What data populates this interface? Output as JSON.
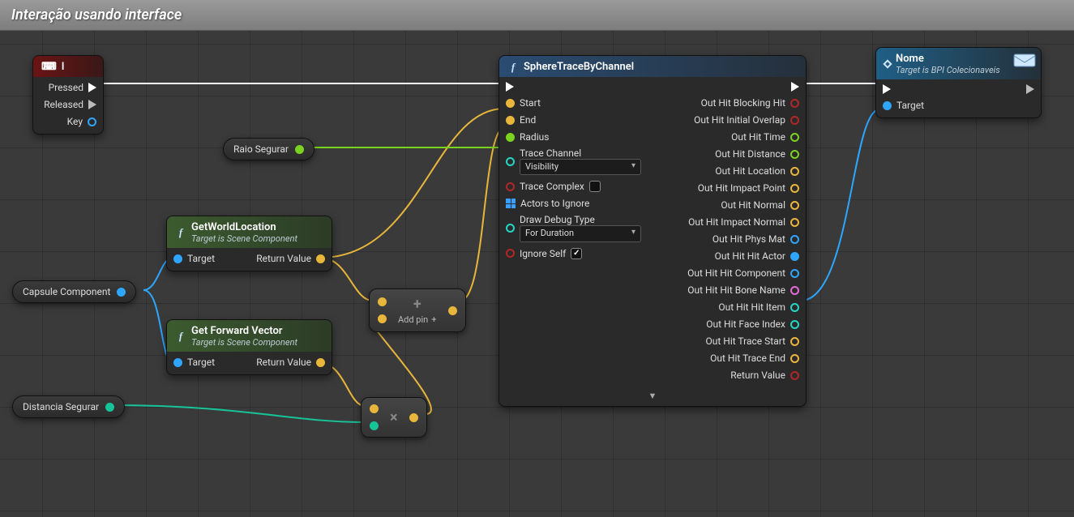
{
  "title": "Interação usando interface",
  "nodes": {
    "event_i": {
      "title": "I",
      "pins": {
        "pressed": "Pressed",
        "released": "Released",
        "key": "Key"
      }
    },
    "raio_segurar": "Raio Segurar",
    "capsule_component": "Capsule Component",
    "distancia_segurar": "Distancia Segurar",
    "get_world_location": {
      "title": "GetWorldLocation",
      "subtitle": "Target is Scene Component",
      "target": "Target",
      "return": "Return Value"
    },
    "get_forward_vector": {
      "title": "Get Forward Vector",
      "subtitle": "Target is Scene Component",
      "target": "Target",
      "return": "Return Value"
    },
    "add_node": {
      "add_pin": "Add pin"
    },
    "sphere_trace": {
      "title": "SphereTraceByChannel",
      "inputs": {
        "start": "Start",
        "end": "End",
        "radius": "Radius",
        "trace_channel": "Trace Channel",
        "visibility_value": "Visibility",
        "trace_complex": "Trace Complex",
        "actors_to_ignore": "Actors to Ignore",
        "draw_debug_type": "Draw Debug Type",
        "draw_debug_value": "For Duration",
        "ignore_self": "Ignore Self"
      },
      "outputs": {
        "blocking_hit": "Out Hit Blocking Hit",
        "initial_overlap": "Out Hit Initial Overlap",
        "time": "Out Hit Time",
        "distance": "Out Hit Distance",
        "location": "Out Hit Location",
        "impact_point": "Out Hit Impact Point",
        "normal": "Out Hit Normal",
        "impact_normal": "Out Hit Impact Normal",
        "phys_mat": "Out Hit Phys Mat",
        "hit_actor": "Out Hit Hit Actor",
        "hit_component": "Out Hit Hit Component",
        "bone_name": "Out Hit Hit Bone Name",
        "hit_item": "Out Hit Hit Item",
        "face_index": "Out Hit Face Index",
        "trace_start": "Out Hit Trace Start",
        "trace_end": "Out Hit Trace End",
        "return": "Return Value"
      }
    },
    "nome": {
      "title": "Nome",
      "subtitle": "Target is BPI Colecionaveis",
      "target": "Target"
    }
  }
}
